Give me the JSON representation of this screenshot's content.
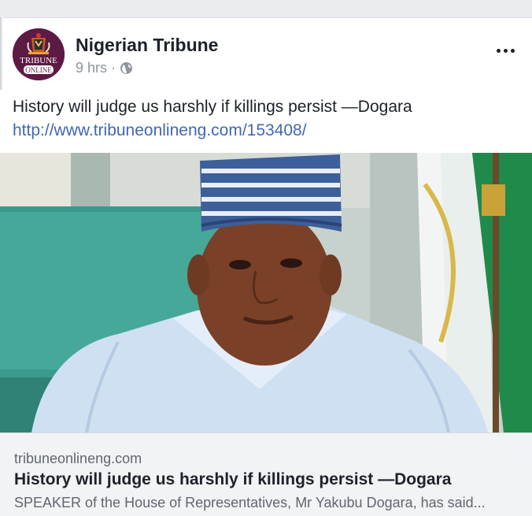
{
  "post": {
    "page_name": "Nigerian Tribune",
    "time": "9 hrs",
    "separator": "·",
    "privacy_icon": "globe-icon",
    "more_icon": "more-options-icon",
    "text": "History will judge us harshly if killings persist —Dogara",
    "link": "http://www.tribuneonlineng.com/153408/"
  },
  "avatar": {
    "line1": "TRIBUNE",
    "line2": "ONLINE"
  },
  "link_card": {
    "domain": "tribuneonlineng.com",
    "title": "History will judge us harshly if killings persist —Dogara",
    "description": "SPEAKER of the House of Representatives, Mr Yakubu Dogara, has said..."
  },
  "colors": {
    "link": "#4267b2",
    "avatar_bg": "#5d1a45",
    "card_bg": "#f2f3f5"
  }
}
